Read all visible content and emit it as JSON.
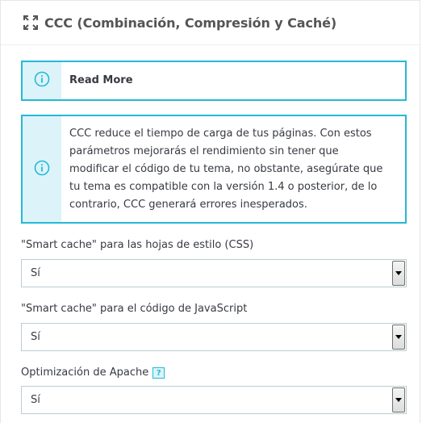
{
  "panel": {
    "title": "CCC (Combinación, Compresión y Caché)",
    "title_icon": "expand-arrows-icon"
  },
  "alerts": {
    "read_more": {
      "text": "Read More",
      "icon": "info-circle-icon"
    },
    "info": {
      "icon": "info-circle-icon",
      "lines": [
        "CCC reduce el tiempo de carga de tus páginas. Con estos",
        "parámetros mejorarás el rendimiento sin tener que",
        "modificar el código de tu tema, no obstante, asegúrate que",
        "tu tema es compatible con la versión 1.4 o posterior, de lo",
        "contrario, CCC generará errores inesperados."
      ]
    }
  },
  "fields": [
    {
      "label": "\"Smart cache\" para las hojas de estilo (CSS)",
      "value": "Sí"
    },
    {
      "label": "\"Smart cache\" para el código de JavaScript",
      "value": "Sí"
    },
    {
      "label": "Optimización de Apache",
      "value": "Sí",
      "help": "?"
    }
  ],
  "colors": {
    "accent": "#25b9d7",
    "accent_light": "#dcf4f9",
    "text": "#363a41"
  }
}
